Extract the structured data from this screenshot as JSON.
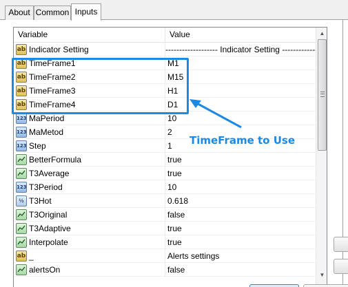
{
  "tabs": [
    {
      "label": "About"
    },
    {
      "label": "Common"
    },
    {
      "label": "Inputs"
    }
  ],
  "table": {
    "columns": [
      "Variable",
      "Value"
    ],
    "rows": [
      {
        "icon": "ab",
        "name": "Indicator Setting",
        "value": "------------------- Indicator Setting -----------------"
      },
      {
        "icon": "ab",
        "name": "TimeFrame1",
        "value": "M1"
      },
      {
        "icon": "ab",
        "name": "TimeFrame2",
        "value": "M15"
      },
      {
        "icon": "ab",
        "name": "TimeFrame3",
        "value": "H1"
      },
      {
        "icon": "ab",
        "name": "TimeFrame4",
        "value": "D1"
      },
      {
        "icon": "123",
        "name": "MaPeriod",
        "value": "10"
      },
      {
        "icon": "123",
        "name": "MaMetod",
        "value": "2"
      },
      {
        "icon": "123",
        "name": "Step",
        "value": "1"
      },
      {
        "icon": "bool",
        "name": "BetterFormula",
        "value": "true"
      },
      {
        "icon": "bool",
        "name": "T3Average",
        "value": "true"
      },
      {
        "icon": "123",
        "name": "T3Period",
        "value": "10"
      },
      {
        "icon": "1/2",
        "name": "T3Hot",
        "value": "0.618"
      },
      {
        "icon": "bool",
        "name": "T3Original",
        "value": "false"
      },
      {
        "icon": "bool",
        "name": "T3Adaptive",
        "value": "true"
      },
      {
        "icon": "bool",
        "name": "Interpolate",
        "value": "true"
      },
      {
        "icon": "ab",
        "name": "_",
        "value": "Alerts settings"
      },
      {
        "icon": "bool",
        "name": "alertsOn",
        "value": "false"
      }
    ]
  },
  "annotation": {
    "text": "TimeFrame to Use",
    "color": "#1a8ae6"
  }
}
